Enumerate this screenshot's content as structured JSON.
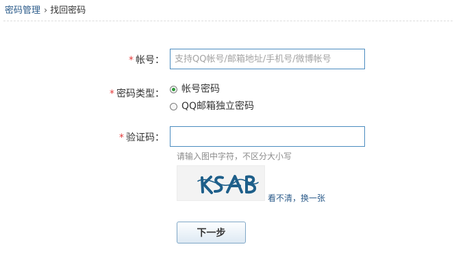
{
  "breadcrumb": {
    "parent": "密码管理",
    "separator": "›",
    "current": "找回密码"
  },
  "form": {
    "required_mark": "*",
    "account": {
      "label": "帐号：",
      "placeholder": "支持QQ帐号/邮箱地址/手机号/微博帐号",
      "value": ""
    },
    "password_type": {
      "label": "密码类型：",
      "options": [
        {
          "label": "帐号密码",
          "checked": true
        },
        {
          "label": "QQ邮箱独立密码",
          "checked": false
        }
      ]
    },
    "captcha": {
      "label": "验证码：",
      "value": "",
      "hint": "请输入图中字符，不区分大小写",
      "image_text": "KSAB",
      "refresh_label": "看不清，换一张"
    },
    "next_button": "下一步"
  },
  "colors": {
    "link": "#2b5b8a",
    "required": "#e43c3c",
    "input_border": "#4a8bbf",
    "captcha_ink": "#1e5f8a",
    "radio_checked": "#2e9a3a"
  }
}
